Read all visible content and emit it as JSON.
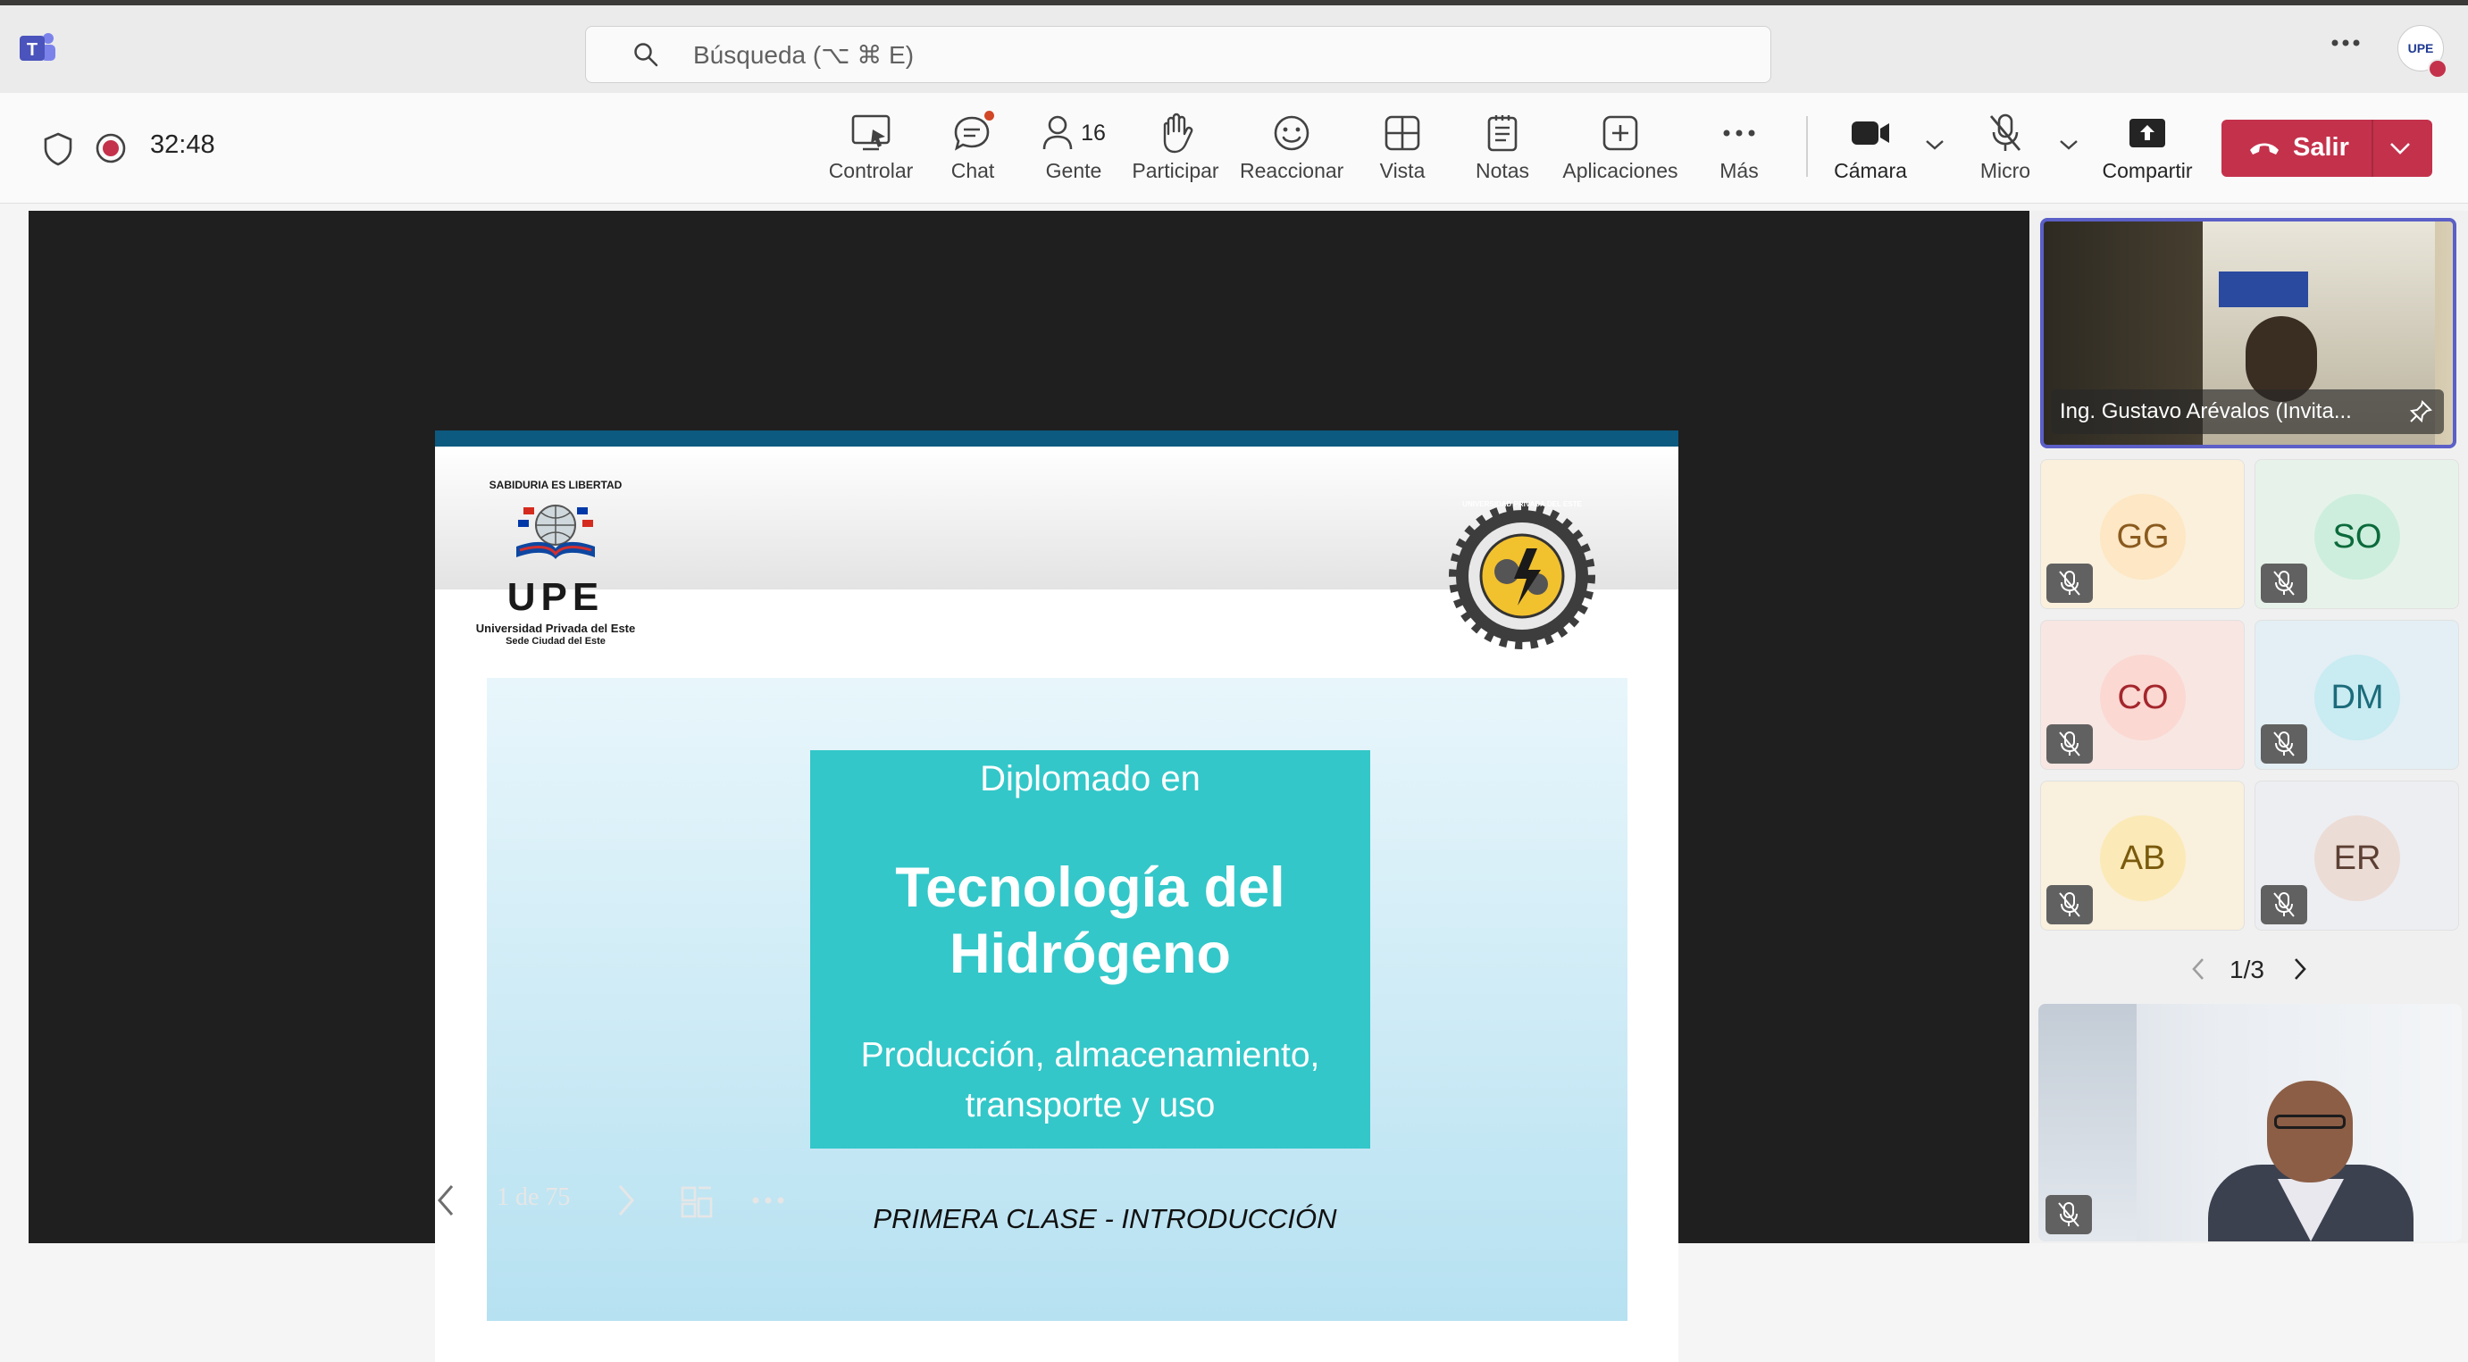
{
  "search": {
    "placeholder": "Búsqueda (⌥ ⌘ E)"
  },
  "meeting": {
    "timer": "32:48"
  },
  "toolbar": {
    "controlar": "Controlar",
    "chat": "Chat",
    "people": "Gente",
    "people_count": "16",
    "participar": "Participar",
    "reaccionar": "Reaccionar",
    "vista": "Vista",
    "notas": "Notas",
    "aplicaciones": "Aplicaciones",
    "mas": "Más",
    "camara": "Cámara",
    "micro": "Micro",
    "compartir": "Compartir",
    "salir": "Salir"
  },
  "account": {
    "avatar_text": "UPE"
  },
  "slide": {
    "upe_logo_text": "UPE",
    "upe_motto": "SABIDURIA ES LIBERTAD",
    "upe_name": "Universidad Privada del Este",
    "upe_sede": "Sede Ciudad del Este",
    "seal_text": "UNIVERSIDAD PRIVADA DEL ESTE",
    "heading_small": "Diplomado en",
    "heading_line1": "Tecnología del",
    "heading_line2": "Hidrógeno",
    "subheading_line1": "Producción, almacenamiento,",
    "subheading_line2": "transporte y uso",
    "footer": "PRIMERA CLASE - INTRODUCCIÓN"
  },
  "slide_nav": {
    "counter": "1 de 75"
  },
  "participants": {
    "featured_name": "Ing. Gustavo Arévalos (Invita...",
    "tiles": [
      {
        "initials": "GG",
        "bg": "#fbf0dc",
        "fg": "#8a5a1e",
        "circle": "#fde7c4"
      },
      {
        "initials": "SO",
        "bg": "#e7f3ea",
        "fg": "#0b6a3b",
        "circle": "#cdeedd"
      },
      {
        "initials": "CO",
        "bg": "#f8e6e2",
        "fg": "#a4262c",
        "circle": "#fbd8d2"
      },
      {
        "initials": "DM",
        "bg": "#e3eff4",
        "fg": "#1b6b7b",
        "circle": "#c9ebf2"
      },
      {
        "initials": "AB",
        "bg": "#f9f0dd",
        "fg": "#7a5a0c",
        "circle": "#fbeab7"
      },
      {
        "initials": "ER",
        "bg": "#edeef2",
        "fg": "#5c4033",
        "circle": "#ecdcd6"
      }
    ],
    "pagination": "1/3"
  }
}
